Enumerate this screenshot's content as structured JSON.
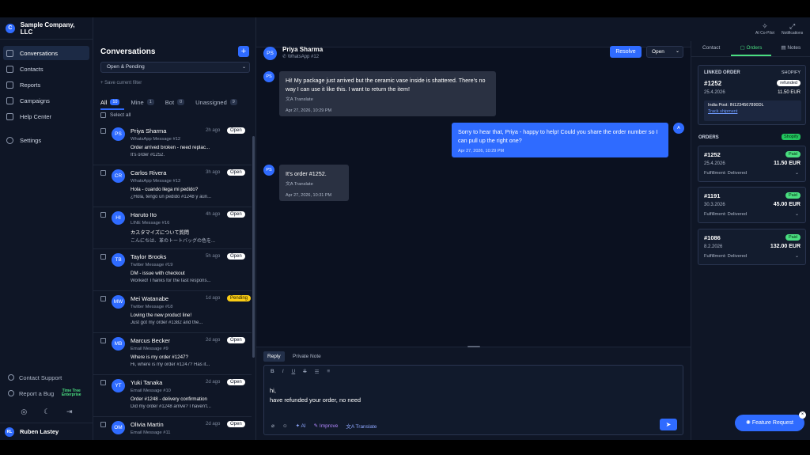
{
  "app": {
    "company": "Sample Company, LLC"
  },
  "sidebar": {
    "items": [
      {
        "label": "Conversations",
        "icon": "chat-icon",
        "active": true
      },
      {
        "label": "Contacts",
        "icon": "contacts-icon"
      },
      {
        "label": "Reports",
        "icon": "reports-icon"
      },
      {
        "label": "Campaigns",
        "icon": "campaigns-icon"
      },
      {
        "label": "Help Center",
        "icon": "help-center-icon"
      },
      {
        "label": "Settings",
        "icon": "settings-icon"
      }
    ],
    "contact_support": "Contact Support",
    "report_bug": "Report a Bug",
    "time_tree_badge": "Time Tree Enterprise",
    "user": {
      "initials": "RL",
      "name": "Ruben Lastey"
    }
  },
  "conversations": {
    "title": "Conversations",
    "filter": "Open & Pending",
    "save_filter": "Save current filter",
    "tabs": [
      {
        "label": "All",
        "count": "10"
      },
      {
        "label": "Mine",
        "count": "1"
      },
      {
        "label": "Bot",
        "count": "0"
      },
      {
        "label": "Unassigned",
        "count": "9"
      }
    ],
    "select_all": "Select all",
    "items": [
      {
        "initials": "PS",
        "name": "Priya Sharma",
        "time": "2h ago",
        "status": "Open",
        "channel": "WhatsApp Message #12",
        "subject": "Order arrived broken - need replac...",
        "preview": "It's order #1252."
      },
      {
        "initials": "CR",
        "name": "Carlos Rivera",
        "time": "3h ago",
        "status": "Open",
        "channel": "WhatsApp Message #13",
        "subject": "Hola - cuando llega mi pedido?",
        "preview": "¿Hola, tengo un pedido #1248 y aún..."
      },
      {
        "initials": "HI",
        "name": "Haruto Ito",
        "time": "4h ago",
        "status": "Open",
        "channel": "LINE Message #16",
        "subject": "カスタマイズについて質問",
        "preview": "こんにちは、革のトートバッグの色を..."
      },
      {
        "initials": "TB",
        "name": "Taylor Brooks",
        "time": "5h ago",
        "status": "Open",
        "channel": "Twitter Message #19",
        "subject": "DM - issue with checkout",
        "preview": "Worked! Thanks for the fast respons..."
      },
      {
        "initials": "MW",
        "name": "Mei Watanabe",
        "time": "1d ago",
        "status": "Pending",
        "channel": "Twitter Message #18",
        "subject": "Loving the new product line!",
        "preview": "Just got my order #1382 and the..."
      },
      {
        "initials": "MB",
        "name": "Marcus Becker",
        "time": "2d ago",
        "status": "Open",
        "channel": "Email Message #9",
        "subject": "Where is my order #1247?",
        "preview": "Hi, where is my order #1247? Has it..."
      },
      {
        "initials": "YT",
        "name": "Yuki Tanaka",
        "time": "2d ago",
        "status": "Open",
        "channel": "Email Message #10",
        "subject": "Order #1248 - delivery confirmation",
        "preview": "Did my order #1248 arrive? I haven't..."
      },
      {
        "initials": "OM",
        "name": "Olivia Martin",
        "time": "2d ago",
        "status": "Open",
        "channel": "Email Message #11",
        "subject": "",
        "preview": ""
      }
    ]
  },
  "chat": {
    "contact_initials": "PS",
    "contact_name": "Priya Sharma",
    "channel": "WhatsApp #12",
    "resolve": "Resolve",
    "status": "Open",
    "messages": [
      {
        "dir": "in",
        "text": "Hi! My package just arrived but the ceramic vase inside is shattered. There's no way I can use it like this. I want to return the item!",
        "translate": "Translate",
        "time": "Apr 27, 2026, 10:29 PM"
      },
      {
        "dir": "out",
        "text": "Sorry to hear that, Priya - happy to help! Could you share the order number so I can pull up the right one?",
        "time": "Apr 27, 2026, 10:29 PM",
        "avatar": "A"
      },
      {
        "dir": "in",
        "text": "It's order #1252.",
        "translate": "Translate",
        "time": "Apr 27, 2026, 10:31 PM"
      }
    ],
    "composer": {
      "tab_reply": "Reply",
      "tab_note": "Private Note",
      "line1": "hi,",
      "line2": "have refunded your order, no need",
      "ai": "AI",
      "improve": "Improve",
      "translate": "Translate"
    }
  },
  "topright": {
    "copilot": "AI Co-Pilot",
    "notifications": "Notifications"
  },
  "rpanel": {
    "tabs": [
      "Contact",
      "Orders",
      "Notes"
    ],
    "linked_order": {
      "label": "LINKED ORDER",
      "source": "SHOPIFY",
      "number": "#1252",
      "status": "refunded",
      "date": "25.4.2026",
      "amount": "11.50 EUR",
      "post": "India Post: IN1234567890DL",
      "track": "Track shipment"
    },
    "orders_label": "ORDERS",
    "shopify_badge": "Shopify",
    "orders": [
      {
        "number": "#1252",
        "status": "Paid",
        "date": "25.4.2026",
        "amount": "11.50 EUR",
        "fulfillment": "Fulfillment: Delivered"
      },
      {
        "number": "#1191",
        "status": "Paid",
        "date": "30.3.2026",
        "amount": "45.00 EUR",
        "fulfillment": "Fulfillment: Delivered"
      },
      {
        "number": "#1086",
        "status": "Paid",
        "date": "8.2.2026",
        "amount": "132.00 EUR",
        "fulfillment": "Fulfillment: Delivered"
      }
    ]
  },
  "feature_request": "Feature Request"
}
